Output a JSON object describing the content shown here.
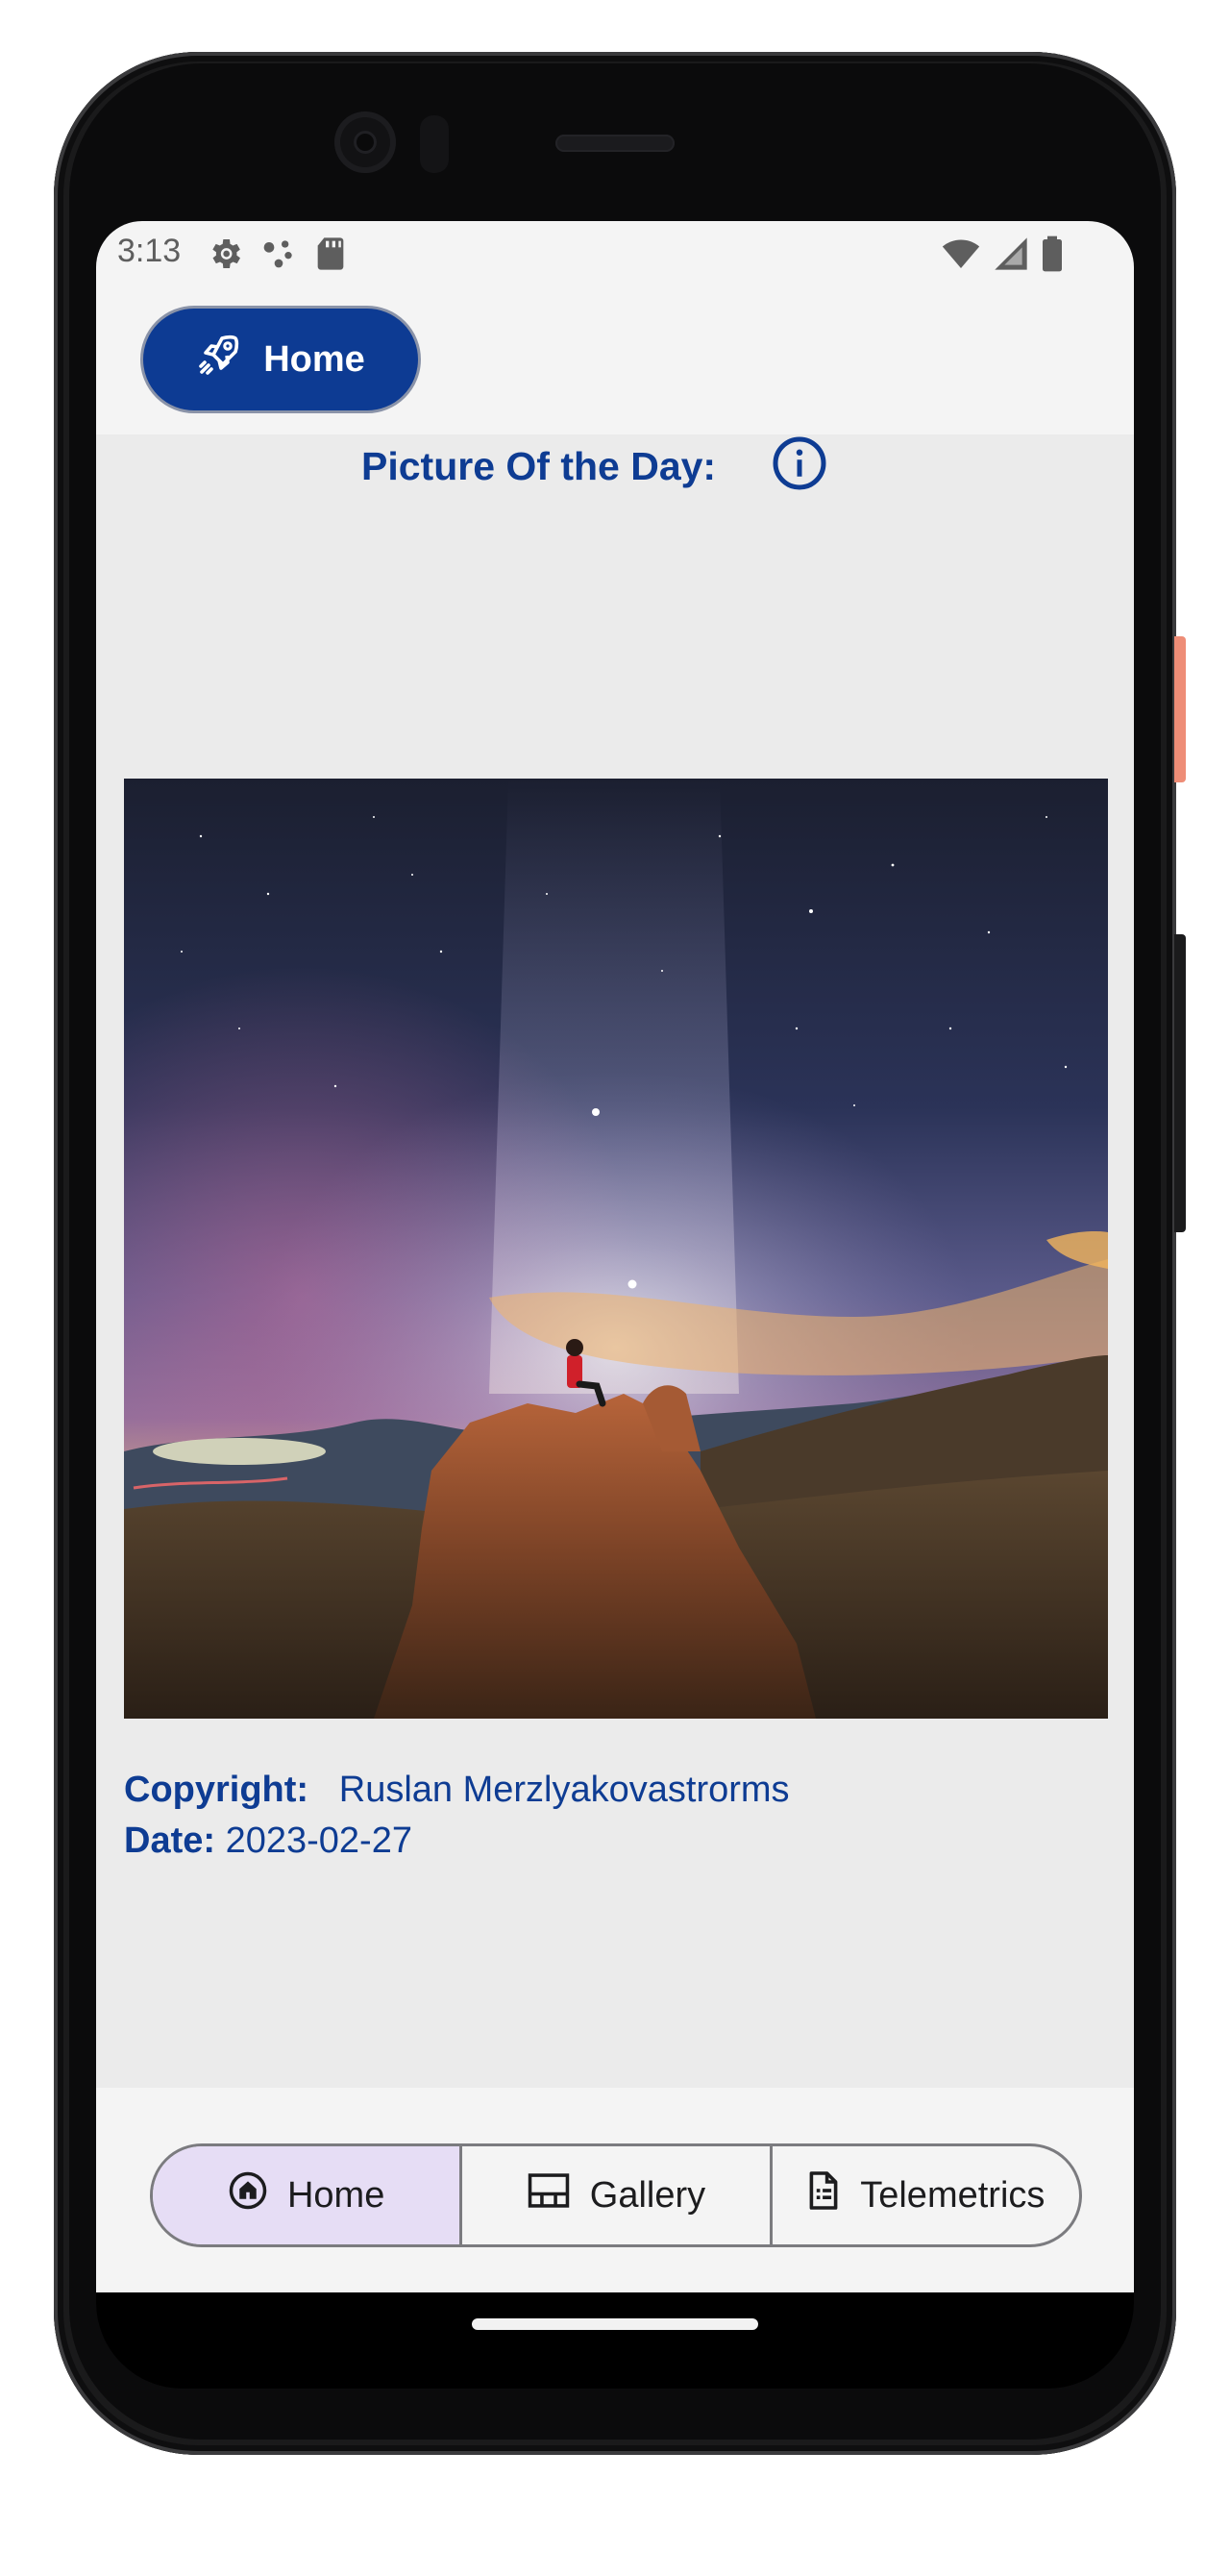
{
  "status_bar": {
    "time": "3:13",
    "left_icons": [
      "settings-icon",
      "dots-icon",
      "sd-card-icon"
    ],
    "right_icons": [
      "wifi-icon",
      "signal-icon",
      "battery-icon"
    ]
  },
  "top_chip": {
    "icon": "rocket-icon",
    "label": "Home"
  },
  "main": {
    "title": "Picture Of the Day:",
    "info_icon": "info-icon",
    "image": {
      "subject": "night-sky-photo"
    },
    "copyright_label": "Copyright:",
    "copyright_value": "Ruslan Merzlyakovastrorms",
    "date_label": "Date:",
    "date_value": "2023-02-27"
  },
  "bottom_nav": {
    "items": [
      {
        "label": "Home",
        "icon": "home-icon",
        "selected": true
      },
      {
        "label": "Gallery",
        "icon": "gallery-icon",
        "selected": false
      },
      {
        "label": "Telemetrics",
        "icon": "document-icon",
        "selected": false
      }
    ]
  },
  "colors": {
    "primary": "#0d3b93",
    "title_text": "#0e3c93",
    "content_background": "#ebebeb",
    "selected_segment": "#e6ddf5"
  }
}
